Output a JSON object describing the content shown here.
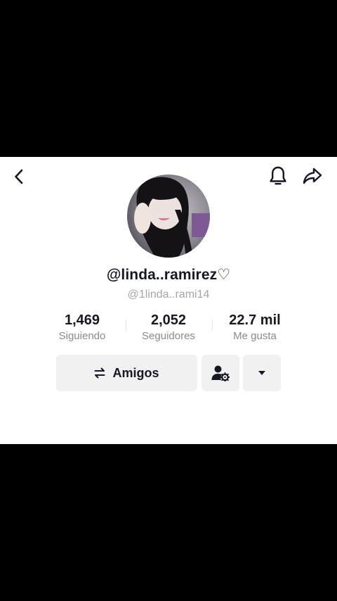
{
  "profile": {
    "username": "@linda..ramirez♡",
    "handle": "@1linda..rami14"
  },
  "stats": {
    "following": {
      "value": "1,469",
      "label": "Siguiendo"
    },
    "followers": {
      "value": "2,052",
      "label": "Seguidores"
    },
    "likes": {
      "value": "22.7 mil",
      "label": "Me gusta"
    }
  },
  "actions": {
    "friends_label": "Amigos"
  },
  "icons": {
    "back": "chevron-left-icon",
    "notifications": "bell-icon",
    "share": "share-arrow-icon",
    "friends": "swap-arrows-icon",
    "person_settings": "person-gear-icon",
    "more": "caret-down-icon"
  },
  "colors": {
    "primary_text": "#161823",
    "secondary_text": "#8a8b91",
    "button_bg": "#f1f1f2",
    "background": "#ffffff"
  }
}
